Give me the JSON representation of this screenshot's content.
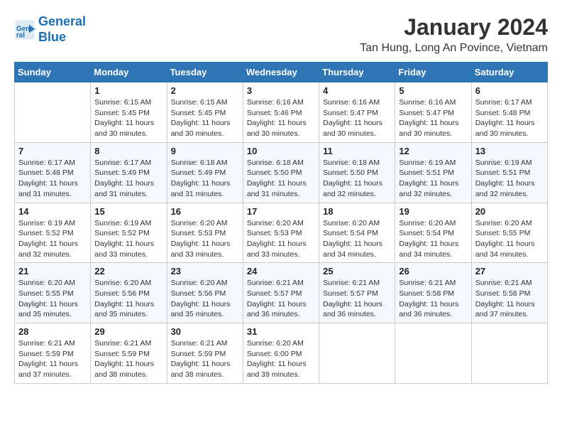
{
  "header": {
    "logo_line1": "General",
    "logo_line2": "Blue",
    "month": "January 2024",
    "location": "Tan Hung, Long An Povince, Vietnam"
  },
  "days_of_week": [
    "Sunday",
    "Monday",
    "Tuesday",
    "Wednesday",
    "Thursday",
    "Friday",
    "Saturday"
  ],
  "weeks": [
    [
      {
        "day": "",
        "text": ""
      },
      {
        "day": "1",
        "text": "Sunrise: 6:15 AM\nSunset: 5:45 PM\nDaylight: 11 hours\nand 30 minutes."
      },
      {
        "day": "2",
        "text": "Sunrise: 6:15 AM\nSunset: 5:45 PM\nDaylight: 11 hours\nand 30 minutes."
      },
      {
        "day": "3",
        "text": "Sunrise: 6:16 AM\nSunset: 5:46 PM\nDaylight: 11 hours\nand 30 minutes."
      },
      {
        "day": "4",
        "text": "Sunrise: 6:16 AM\nSunset: 5:47 PM\nDaylight: 11 hours\nand 30 minutes."
      },
      {
        "day": "5",
        "text": "Sunrise: 6:16 AM\nSunset: 5:47 PM\nDaylight: 11 hours\nand 30 minutes."
      },
      {
        "day": "6",
        "text": "Sunrise: 6:17 AM\nSunset: 5:48 PM\nDaylight: 11 hours\nand 30 minutes."
      }
    ],
    [
      {
        "day": "7",
        "text": "Sunrise: 6:17 AM\nSunset: 5:48 PM\nDaylight: 11 hours\nand 31 minutes."
      },
      {
        "day": "8",
        "text": "Sunrise: 6:17 AM\nSunset: 5:49 PM\nDaylight: 11 hours\nand 31 minutes."
      },
      {
        "day": "9",
        "text": "Sunrise: 6:18 AM\nSunset: 5:49 PM\nDaylight: 11 hours\nand 31 minutes."
      },
      {
        "day": "10",
        "text": "Sunrise: 6:18 AM\nSunset: 5:50 PM\nDaylight: 11 hours\nand 31 minutes."
      },
      {
        "day": "11",
        "text": "Sunrise: 6:18 AM\nSunset: 5:50 PM\nDaylight: 11 hours\nand 32 minutes."
      },
      {
        "day": "12",
        "text": "Sunrise: 6:19 AM\nSunset: 5:51 PM\nDaylight: 11 hours\nand 32 minutes."
      },
      {
        "day": "13",
        "text": "Sunrise: 6:19 AM\nSunset: 5:51 PM\nDaylight: 11 hours\nand 32 minutes."
      }
    ],
    [
      {
        "day": "14",
        "text": "Sunrise: 6:19 AM\nSunset: 5:52 PM\nDaylight: 11 hours\nand 32 minutes."
      },
      {
        "day": "15",
        "text": "Sunrise: 6:19 AM\nSunset: 5:52 PM\nDaylight: 11 hours\nand 33 minutes."
      },
      {
        "day": "16",
        "text": "Sunrise: 6:20 AM\nSunset: 5:53 PM\nDaylight: 11 hours\nand 33 minutes."
      },
      {
        "day": "17",
        "text": "Sunrise: 6:20 AM\nSunset: 5:53 PM\nDaylight: 11 hours\nand 33 minutes."
      },
      {
        "day": "18",
        "text": "Sunrise: 6:20 AM\nSunset: 5:54 PM\nDaylight: 11 hours\nand 34 minutes."
      },
      {
        "day": "19",
        "text": "Sunrise: 6:20 AM\nSunset: 5:54 PM\nDaylight: 11 hours\nand 34 minutes."
      },
      {
        "day": "20",
        "text": "Sunrise: 6:20 AM\nSunset: 5:55 PM\nDaylight: 11 hours\nand 34 minutes."
      }
    ],
    [
      {
        "day": "21",
        "text": "Sunrise: 6:20 AM\nSunset: 5:55 PM\nDaylight: 11 hours\nand 35 minutes."
      },
      {
        "day": "22",
        "text": "Sunrise: 6:20 AM\nSunset: 5:56 PM\nDaylight: 11 hours\nand 35 minutes."
      },
      {
        "day": "23",
        "text": "Sunrise: 6:20 AM\nSunset: 5:56 PM\nDaylight: 11 hours\nand 35 minutes."
      },
      {
        "day": "24",
        "text": "Sunrise: 6:21 AM\nSunset: 5:57 PM\nDaylight: 11 hours\nand 36 minutes."
      },
      {
        "day": "25",
        "text": "Sunrise: 6:21 AM\nSunset: 5:57 PM\nDaylight: 11 hours\nand 36 minutes."
      },
      {
        "day": "26",
        "text": "Sunrise: 6:21 AM\nSunset: 5:58 PM\nDaylight: 11 hours\nand 36 minutes."
      },
      {
        "day": "27",
        "text": "Sunrise: 6:21 AM\nSunset: 5:58 PM\nDaylight: 11 hours\nand 37 minutes."
      }
    ],
    [
      {
        "day": "28",
        "text": "Sunrise: 6:21 AM\nSunset: 5:59 PM\nDaylight: 11 hours\nand 37 minutes."
      },
      {
        "day": "29",
        "text": "Sunrise: 6:21 AM\nSunset: 5:59 PM\nDaylight: 11 hours\nand 38 minutes."
      },
      {
        "day": "30",
        "text": "Sunrise: 6:21 AM\nSunset: 5:59 PM\nDaylight: 11 hours\nand 38 minutes."
      },
      {
        "day": "31",
        "text": "Sunrise: 6:20 AM\nSunset: 6:00 PM\nDaylight: 11 hours\nand 39 minutes."
      },
      {
        "day": "",
        "text": ""
      },
      {
        "day": "",
        "text": ""
      },
      {
        "day": "",
        "text": ""
      }
    ]
  ]
}
